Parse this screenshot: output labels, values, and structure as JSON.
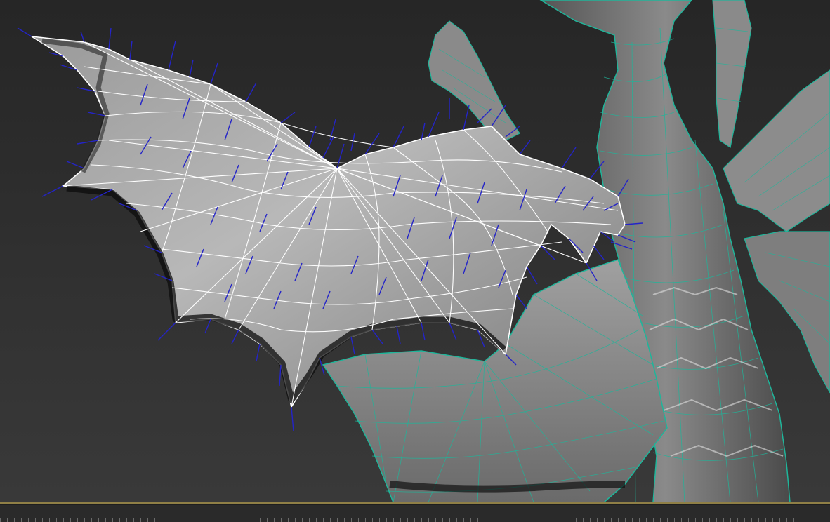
{
  "app": {
    "view": "3d-viewport-perspective"
  },
  "colors": {
    "background_top": "#262626",
    "background_bottom": "#3a3a3a",
    "mesh_shade_light": "#b4b4b4",
    "mesh_shade_dark": "#5a5a5a",
    "mesh_shadow": "#101010",
    "selected_wireframe": "#ffffff",
    "unselected_wireframe": "#1fb59a",
    "normals": "#2424c8",
    "viewport_edge": "#8f7f46",
    "timeline_bg": "#2a2a2a"
  },
  "icons": {
    "selected_object": "bat-wing-mesh-icon",
    "normals": "vertex-normal-lines-icon"
  }
}
